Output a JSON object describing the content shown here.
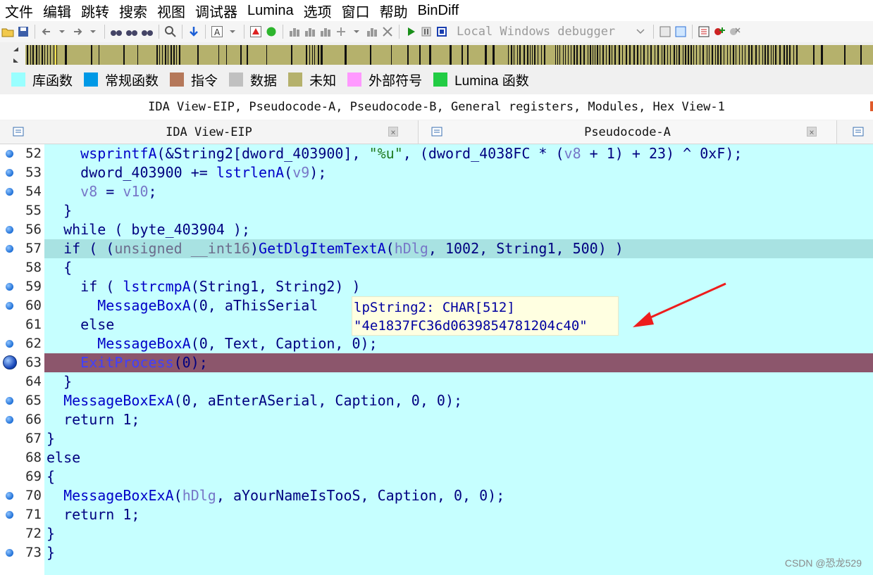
{
  "menu": [
    "文件",
    "编辑",
    "跳转",
    "搜索",
    "视图",
    "调试器",
    "Lumina",
    "选项",
    "窗口",
    "帮助",
    "BinDiff"
  ],
  "toolbar": {
    "debugger_label": "Local Windows debugger",
    "icons": [
      "open-icon",
      "save-icon",
      "back-arrow-icon",
      "forward-arrow-icon",
      "search-icon",
      "download-icon",
      "text-icon",
      "stop-icon",
      "run-green-icon",
      "play-icon",
      "pause-icon",
      "stop-square-icon"
    ]
  },
  "legend": [
    {
      "label": "库函数",
      "color": "#99ffff"
    },
    {
      "label": "常规函数",
      "color": "#0099e6"
    },
    {
      "label": "指令",
      "color": "#b5785a"
    },
    {
      "label": "数据",
      "color": "#c0c0c0"
    },
    {
      "label": "未知",
      "color": "#b5b16c"
    },
    {
      "label": "外部符号",
      "color": "#ff99ff"
    },
    {
      "label": "Lumina 函数",
      "color": "#22cc44"
    }
  ],
  "windows_list": "IDA View-EIP, Pseudocode-A, Pseudocode-B, General registers, Modules, Hex View-1",
  "tabs": [
    {
      "label": "IDA View-EIP",
      "close": "×"
    },
    {
      "label": "Pseudocode-A",
      "close": "×"
    }
  ],
  "code_lines": [
    {
      "num": "52",
      "bp": "dot",
      "html": "    <span class=\"c-fn\">wsprintfA</span>(&amp;String2[dword_403900], <span class=\"c-str\">\"%u\"</span>, (dword_4038FC * (<span class=\"c-var\">v8</span> + 1) + 23) ^ 0xF);"
    },
    {
      "num": "53",
      "bp": "dot",
      "html": "    dword_403900 += <span class=\"c-fn\">lstrlenA</span>(<span class=\"c-var\">v9</span>);"
    },
    {
      "num": "54",
      "bp": "dot",
      "html": "    <span class=\"c-var\">v8</span> = <span class=\"c-var\">v10</span>;"
    },
    {
      "num": "55",
      "bp": "none",
      "html": "  }"
    },
    {
      "num": "56",
      "bp": "dot",
      "html": "  while ( byte_403904 );"
    },
    {
      "num": "57",
      "bp": "dot",
      "hl": "#a8e2e2",
      "html": "  if ( (<span class=\"c-type\">unsigned __int16</span>)<span class=\"c-fn\">GetDlgItemTextA</span>(<span class=\"c-var\">hDlg</span>, 1002, String1, 500) )"
    },
    {
      "num": "58",
      "bp": "none",
      "html": "  {"
    },
    {
      "num": "59",
      "bp": "dot",
      "html": "    if ( <span class=\"c-fn\">lstrcmpA</span>(String1, String2) )"
    },
    {
      "num": "60",
      "bp": "dot",
      "html": "      <span class=\"c-fn\">MessageBoxA</span>(0, aThisSerial"
    },
    {
      "num": "61",
      "bp": "none",
      "html": "    else"
    },
    {
      "num": "62",
      "bp": "dot",
      "html": "      <span class=\"c-fn\">MessageBoxA</span>(0, Text, Caption, 0);"
    },
    {
      "num": "63",
      "bp": "eip",
      "hl": "#8c566c",
      "html": "    <span class=\"c-fn\">ExitProcess</span>(0);"
    },
    {
      "num": "64",
      "bp": "none",
      "html": "  }"
    },
    {
      "num": "65",
      "bp": "dot",
      "html": "  <span class=\"c-fn\">MessageBoxExA</span>(0, aEnterASerial, Caption, 0, 0);"
    },
    {
      "num": "66",
      "bp": "dot",
      "html": "  return 1;"
    },
    {
      "num": "67",
      "bp": "none",
      "html": "}"
    },
    {
      "num": "68",
      "bp": "none",
      "html": "else"
    },
    {
      "num": "69",
      "bp": "none",
      "html": "{"
    },
    {
      "num": "70",
      "bp": "dot",
      "html": "  <span class=\"c-fn\">MessageBoxExA</span>(<span class=\"c-var\">hDlg</span>, aYourNameIsTooS, Caption, 0, 0);"
    },
    {
      "num": "71",
      "bp": "dot",
      "html": "  return 1;"
    },
    {
      "num": "72",
      "bp": "none",
      "html": "}"
    },
    {
      "num": "73",
      "bp": "dot",
      "html": "}"
    }
  ],
  "tooltip": {
    "line1": "lpString2: CHAR[512]",
    "line2": "\"4e1837FC36d0639854781204c40\""
  },
  "watermark": "CSDN @恐龙529"
}
